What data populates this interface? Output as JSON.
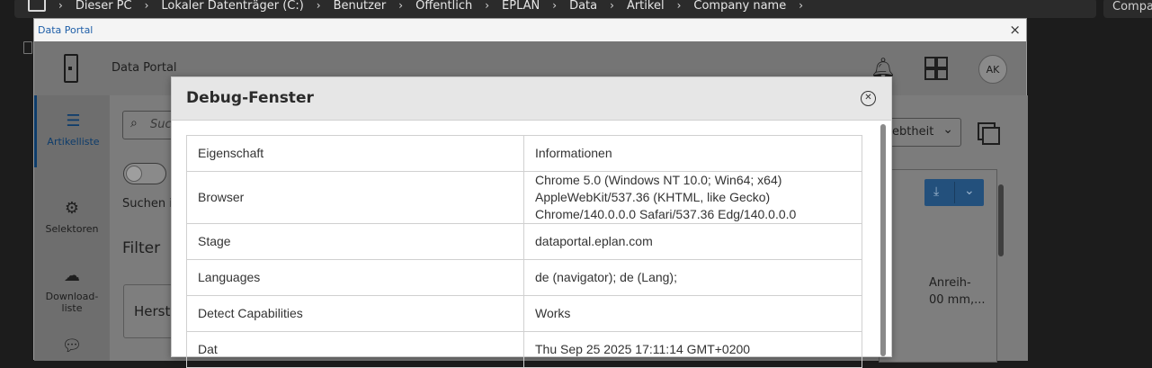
{
  "explorer": {
    "breadcrumbs": [
      "Dieser PC",
      "Lokaler Datenträger (C:)",
      "Benutzer",
      "Öffentlich",
      "EPLAN",
      "Data",
      "Artikel",
      "Company name"
    ],
    "search_text": "Compa"
  },
  "window": {
    "title": "Data Portal",
    "close_symbol": "×"
  },
  "app": {
    "title": "Data Portal",
    "avatar_initials": "AK",
    "nav": {
      "articles": "Artikelliste",
      "selectors": "Selektoren",
      "downloads_line1": "Download-",
      "downloads_line2": "liste"
    },
    "search_placeholder": "Suc",
    "search_in_label": "Suchen i",
    "filter_heading": "Filter",
    "manufacturer_field": "Herst",
    "sort_value": "ebtheit",
    "result_text_line1": "Anreih-",
    "result_text_line2": "00 mm,..."
  },
  "debug": {
    "title": "Debug-Fenster",
    "rows": [
      {
        "key": "Eigenschaft",
        "value": [
          "Informationen"
        ]
      },
      {
        "key": "Browser",
        "value": [
          "Chrome 5.0 (Windows NT 10.0; Win64; x64)",
          "AppleWebKit/537.36 (KHTML, like Gecko)",
          "Chrome/140.0.0.0 Safari/537.36 Edg/140.0.0.0"
        ]
      },
      {
        "key": "Stage",
        "value": [
          "dataportal.eplan.com"
        ]
      },
      {
        "key": "Languages",
        "value": [
          "de (navigator); de (Lang);"
        ]
      },
      {
        "key": "Detect Capabilities",
        "value": [
          "Works"
        ]
      },
      {
        "key": "Dat",
        "value": [
          "Thu Sep 25 2025 17:11:14 GMT+0200"
        ]
      }
    ]
  },
  "colors": {
    "accent": "#0d3c6b",
    "download_button": "#23507c",
    "titlebar_text": "#1f5fa8"
  }
}
